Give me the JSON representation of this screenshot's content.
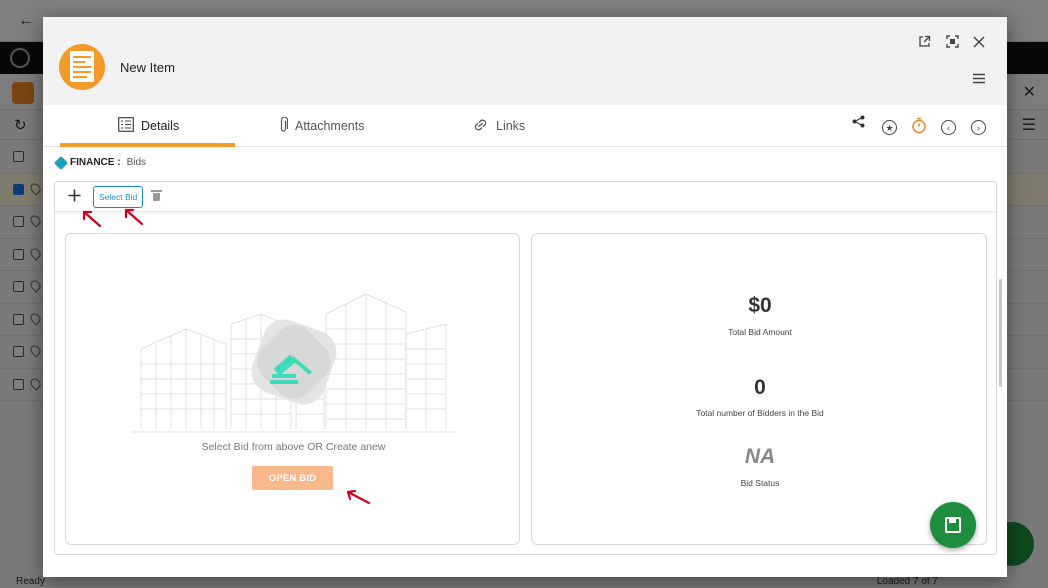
{
  "background": {
    "status_left": "Ready",
    "status_right": "Loaded 7 of 7"
  },
  "modal": {
    "title": "New Item",
    "header_icons": [
      "open-external-icon",
      "fullscreen-icon",
      "close-icon",
      "hamburger-menu-icon"
    ],
    "tabs": [
      {
        "label": "Details",
        "icon": "details-icon",
        "active": true
      },
      {
        "label": "Attachments",
        "icon": "paperclip-icon",
        "active": false
      },
      {
        "label": "Links",
        "icon": "link-icon",
        "active": false
      }
    ],
    "tab_actions": [
      "share-icon",
      "star-icon",
      "timer-icon",
      "previous-icon",
      "next-icon"
    ],
    "breadcrumb": {
      "module": "FINANCE :",
      "section": "Bids"
    },
    "toolbar": {
      "select_bid_label": "Select Bid"
    },
    "empty_state": {
      "message": "Select Bid from above OR Create anew",
      "button_label": "OPEN BID"
    },
    "stats": {
      "total_bid_amount": "$0",
      "total_bid_amount_label": "Total Bid Amount",
      "bidders_count": "0",
      "bidders_count_label": "Total number of Bidders in the Bid",
      "bid_status": "NA",
      "bid_status_label": "Bid Status"
    }
  },
  "colors": {
    "accent_orange": "#f39a2b",
    "open_bid_button": "#f7b88c",
    "select_bid_blue": "#1a8fc7",
    "save_green": "#1e8e3e",
    "gavel_teal": "#3ddbb8",
    "annotation_red": "#d0021b"
  }
}
